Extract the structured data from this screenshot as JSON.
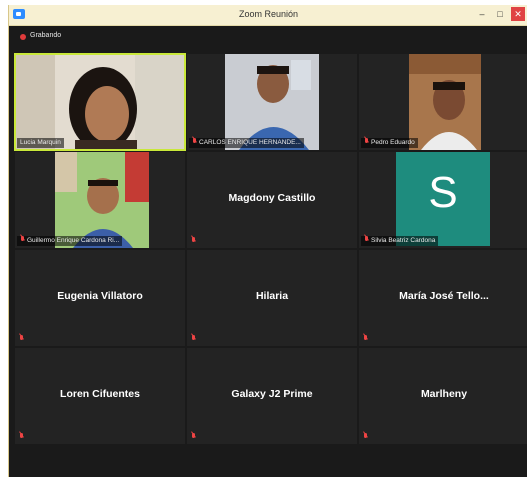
{
  "window": {
    "title": "Zoom Reunión",
    "minimize": "–",
    "maximize": "□",
    "close": "✕"
  },
  "recording": {
    "label": "Grabando"
  },
  "participants": [
    {
      "name": "Lucia Marquin",
      "type": "video"
    },
    {
      "name": "CARLOS ENRIQUE HERNANDE...",
      "type": "video"
    },
    {
      "name": "Pedro Eduardo",
      "type": "video"
    },
    {
      "name": "Guillermo Enrique Cardona Ri...",
      "type": "video"
    },
    {
      "name": "Magdony Castillo",
      "type": "name"
    },
    {
      "name": "Silvia Beatriz Cardona",
      "type": "avatar",
      "initial": "S"
    },
    {
      "name": "Eugenia Villatoro",
      "type": "name"
    },
    {
      "name": "Hilaria",
      "type": "name"
    },
    {
      "name": "María José Tello...",
      "type": "name"
    },
    {
      "name": "Loren Cifuentes",
      "type": "name"
    },
    {
      "name": "Galaxy J2 Prime",
      "type": "name"
    },
    {
      "name": "Marlheny",
      "type": "name"
    }
  ],
  "colors": {
    "active_speaker": "#c9e83a",
    "avatar_bg": "#1e8c7e",
    "muted": "#e44444"
  }
}
